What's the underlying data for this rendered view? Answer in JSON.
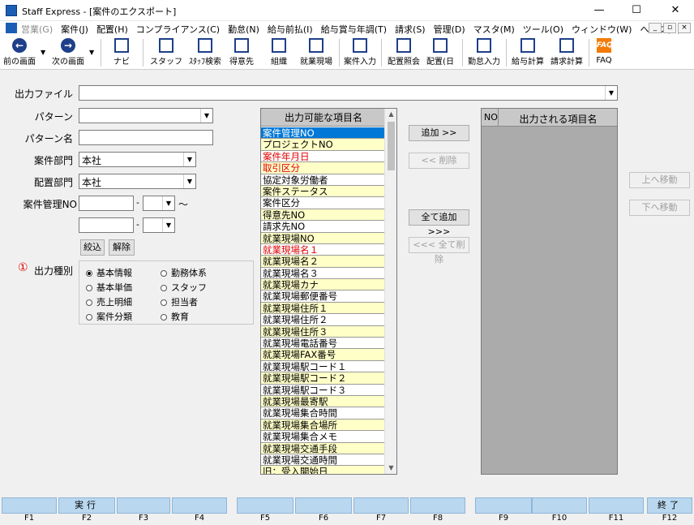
{
  "window": {
    "title": "Staff Express - [案件のエクスポート]"
  },
  "menu": [
    {
      "label": "営業(G)",
      "disabled": true
    },
    {
      "label": "案件(J)"
    },
    {
      "label": "配置(H)"
    },
    {
      "label": "コンプライアンス(C)"
    },
    {
      "label": "勤怠(N)"
    },
    {
      "label": "給与前払(I)"
    },
    {
      "label": "給与賞与年調(T)"
    },
    {
      "label": "請求(S)"
    },
    {
      "label": "管理(D)"
    },
    {
      "label": "マスタ(M)"
    },
    {
      "label": "ツール(O)"
    },
    {
      "label": "ウィンドウ(W)"
    },
    {
      "label": "ヘルプ(H)"
    }
  ],
  "toolbar": {
    "prev": "前の画面",
    "next": "次の画面",
    "navi": "ナビ",
    "staff": "スタッフ",
    "staff_search": "ｽﾀｯﾌ検索",
    "client": "得意先",
    "org": "組織",
    "site": "就業現場",
    "case_input": "案件入力",
    "deploy_inquiry": "配置照会",
    "deploy_day": "配置(日",
    "attendance_input": "勤怠入力",
    "salary_calc": "給与計算",
    "billing_calc": "請求計算",
    "faq": "FAQ"
  },
  "form": {
    "output_file_label": "出力ファイル",
    "output_file_value": "",
    "pattern_label": "パターン",
    "pattern_value": "",
    "pattern_name_label": "パターン名",
    "pattern_name_value": "",
    "case_dept_label": "案件部門",
    "case_dept_value": "本社",
    "deploy_dept_label": "配置部門",
    "deploy_dept_value": "本社",
    "case_no_label": "案件管理NO",
    "dash": "-",
    "tilde": "～",
    "filter_button": "絞込",
    "clear_button": "解除",
    "output_type_marker": "①",
    "output_type_label": "出力種別"
  },
  "output_types": [
    {
      "label": "基本情報",
      "checked": true
    },
    {
      "label": "勤務体系",
      "checked": false
    },
    {
      "label": "基本単価",
      "checked": false
    },
    {
      "label": "スタッフ",
      "checked": false
    },
    {
      "label": "売上明細",
      "checked": false
    },
    {
      "label": "担当者",
      "checked": false
    },
    {
      "label": "案件分類",
      "checked": false
    },
    {
      "label": "教育",
      "checked": false
    }
  ],
  "available_header": "出力可能な項目名",
  "available_items": [
    {
      "text": "案件管理NO",
      "style": "sel"
    },
    {
      "text": "プロジェクトNO",
      "style": "y"
    },
    {
      "text": "案件年月日",
      "style": "w",
      "red": true
    },
    {
      "text": "取引区分",
      "style": "y",
      "red": true
    },
    {
      "text": "協定対象労働者",
      "style": "w"
    },
    {
      "text": "案件ステータス",
      "style": "y"
    },
    {
      "text": "案件区分",
      "style": "w"
    },
    {
      "text": "得意先NO",
      "style": "y"
    },
    {
      "text": "請求先NO",
      "style": "w"
    },
    {
      "text": "就業現場NO",
      "style": "y"
    },
    {
      "text": "就業現場名１",
      "style": "w",
      "red": true
    },
    {
      "text": "就業現場名２",
      "style": "y"
    },
    {
      "text": "就業現場名３",
      "style": "w"
    },
    {
      "text": "就業現場カナ",
      "style": "y"
    },
    {
      "text": "就業現場郵便番号",
      "style": "w"
    },
    {
      "text": "就業現場住所１",
      "style": "y"
    },
    {
      "text": "就業現場住所２",
      "style": "w"
    },
    {
      "text": "就業現場住所３",
      "style": "y"
    },
    {
      "text": "就業現場電話番号",
      "style": "w"
    },
    {
      "text": "就業現場FAX番号",
      "style": "y"
    },
    {
      "text": "就業現場駅コード１",
      "style": "w"
    },
    {
      "text": "就業現場駅コード２",
      "style": "y"
    },
    {
      "text": "就業現場駅コード３",
      "style": "w"
    },
    {
      "text": "就業現場最寄駅",
      "style": "y"
    },
    {
      "text": "就業現場集合時間",
      "style": "w"
    },
    {
      "text": "就業現場集合場所",
      "style": "y"
    },
    {
      "text": "就業現場集合メモ",
      "style": "w"
    },
    {
      "text": "就業現場交通手段",
      "style": "y"
    },
    {
      "text": "就業現場交通時間",
      "style": "w"
    },
    {
      "text": "旧：受入開始日",
      "style": "y"
    }
  ],
  "buttons": {
    "add": "追加 >>",
    "remove": "<< 削除",
    "add_all": "全て追加 >>>",
    "remove_all": "<<< 全て削除",
    "move_up": "上へ移動",
    "move_down": "下へ移動"
  },
  "output_list": {
    "no_header": "NO",
    "name_header": "出力される項目名"
  },
  "fkeys": [
    {
      "key": "F1",
      "label": ""
    },
    {
      "key": "F2",
      "label": "実行"
    },
    {
      "key": "F3",
      "label": ""
    },
    {
      "key": "F4",
      "label": ""
    },
    {
      "key": "F5",
      "label": ""
    },
    {
      "key": "F6",
      "label": ""
    },
    {
      "key": "F7",
      "label": ""
    },
    {
      "key": "F8",
      "label": ""
    },
    {
      "key": "F9",
      "label": ""
    },
    {
      "key": "F10",
      "label": ""
    },
    {
      "key": "F11",
      "label": ""
    },
    {
      "key": "F12",
      "label": "終了"
    }
  ],
  "colors": {
    "selection": "#0078d7",
    "row_yellow": "#ffffc8",
    "fkey": "#b9d7ef",
    "required_red": "#e00000",
    "faq_orange": "#f27b0a"
  }
}
